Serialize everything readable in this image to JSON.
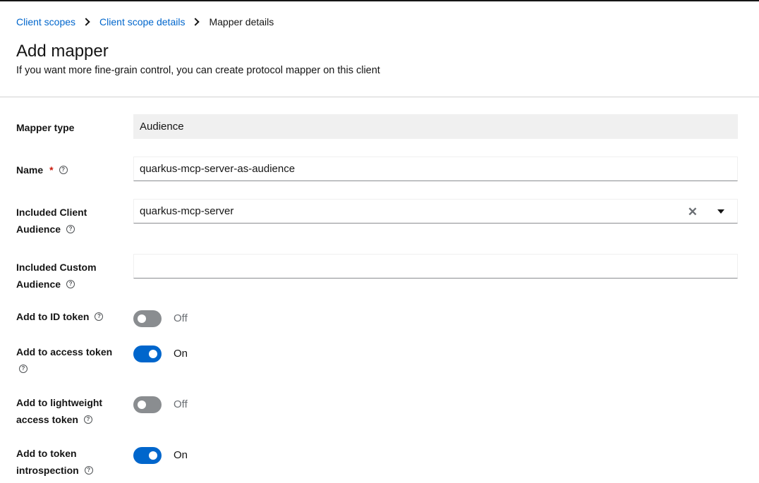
{
  "breadcrumb": {
    "items": [
      "Client scopes",
      "Client scope details"
    ],
    "current": "Mapper details"
  },
  "page": {
    "title": "Add mapper",
    "description": "If you want more fine-grain control, you can create protocol mapper on this client"
  },
  "form": {
    "mapper_type": {
      "label": "Mapper type",
      "value": "Audience"
    },
    "name": {
      "label": "Name",
      "required_mark": "*",
      "value": "quarkus-mcp-server-as-audience"
    },
    "included_client_audience": {
      "label_line1": "Included Client",
      "label_line2": "Audience",
      "value": "quarkus-mcp-server"
    },
    "included_custom_audience": {
      "label_line1": "Included Custom",
      "label_line2": "Audience",
      "value": ""
    },
    "add_to_id_token": {
      "label": "Add to ID token",
      "state": "Off",
      "on": false
    },
    "add_to_access_token": {
      "label": "Add to access token",
      "state": "On",
      "on": true
    },
    "add_to_lightweight": {
      "label_line1": "Add to lightweight",
      "label_line2": "access token",
      "state": "Off",
      "on": false
    },
    "add_to_introspection": {
      "label_line1": "Add to token",
      "label_line2": "introspection",
      "state": "On",
      "on": true
    }
  },
  "icons": {
    "help": "help-circle-icon",
    "clear": "times-icon",
    "dropdown": "caret-down-icon",
    "separator": "angle-right-icon"
  },
  "colors": {
    "link": "#0066cc",
    "switch_on": "#0066cc",
    "switch_off": "#8a8d90",
    "required": "#c9190b",
    "readonly_bg": "#f0f0f0"
  }
}
